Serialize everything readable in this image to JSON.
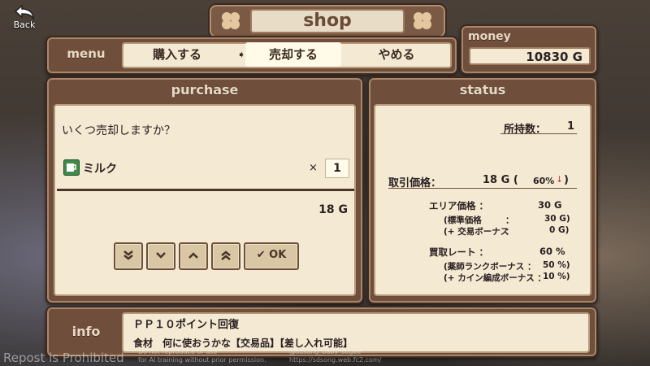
{
  "back": {
    "label": "Back"
  },
  "shop": {
    "title": "shop"
  },
  "menu": {
    "header": "menu",
    "tabs": [
      {
        "label": "購入する"
      },
      {
        "label": "売却する"
      },
      {
        "label": "やめる"
      }
    ],
    "active_index": 1
  },
  "money": {
    "header": "money",
    "amount": "10830 G"
  },
  "purchase": {
    "header": "purchase",
    "question": "いくつ売却しますか？",
    "item_name": "ミルク",
    "item_icon": "milk-mug-icon",
    "times": "×",
    "quantity": "1",
    "total": "18 G",
    "ok_label": "OK"
  },
  "status": {
    "header": "status",
    "owned_label": "所持数：",
    "owned_value": "1",
    "trade_price_label": "取引価格：",
    "trade_price_value": "18 G (",
    "trade_price_pct": "60%",
    "trade_price_close": ")",
    "area_price_label": "エリア価格 ：",
    "area_price_value": "30 G",
    "std_price_label": "(標準価格",
    "std_price_colon": "：",
    "std_price_value": "30 G)",
    "trade_bonus_label": "(+ 交易ボーナス",
    "trade_bonus_colon": "：",
    "trade_bonus_value": "0 G)",
    "buy_rate_label": "買取レート ：",
    "buy_rate_value": "60 %",
    "pharm_bonus_label": "(薬師ランクボーナス ：",
    "pharm_bonus_value": "50 %)",
    "cain_bonus_label": "(+ カイン編成ボーナス ：",
    "cain_bonus_value": "10 %)"
  },
  "info": {
    "header": "info",
    "line1": "ＰＰ１０ポイント回復",
    "line2": "食材　何に使おうかな【交易品】【差し入れ可能】"
  },
  "watermark": {
    "left": "Repost is Prohibited",
    "mid1": "Do not reproduce or use",
    "mid2": "for AI training without prior permission.",
    "right1": "@sdsong_baby_sogee",
    "right2": "https://sdsong.web.fc2.com/"
  },
  "colors": {
    "panel": "#6f4f3c",
    "cream": "#f4e9d3",
    "accent_down": "#d23a3a"
  }
}
